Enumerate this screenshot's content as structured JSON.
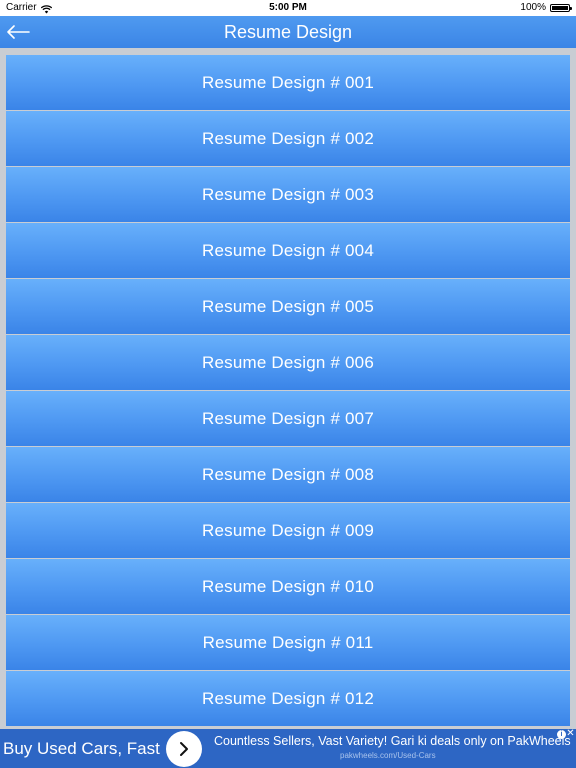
{
  "status_bar": {
    "carrier": "Carrier",
    "time": "5:00 PM",
    "battery": "100%"
  },
  "nav": {
    "title": "Resume Design",
    "back_icon": "back-arrow-icon"
  },
  "list": {
    "items": [
      "Resume Design # 001",
      "Resume Design # 002",
      "Resume Design # 003",
      "Resume Design # 004",
      "Resume Design # 005",
      "Resume Design # 006",
      "Resume Design # 007",
      "Resume Design # 008",
      "Resume Design # 009",
      "Resume Design # 010",
      "Resume Design # 011",
      "Resume Design # 012"
    ]
  },
  "ad": {
    "headline": "Buy Used Cars, Fast",
    "description": "Countless Sellers, Vast Variety! Gari ki deals only on PakWheels",
    "url": "pakwheels.com/Used-Cars",
    "info_label": "i",
    "close_label": "✕"
  },
  "colors": {
    "nav_bar": "#4f9af0",
    "list_item_top": "#68b0fb",
    "list_item_bottom": "#3a84e8",
    "ad_background": "#2d66c4"
  }
}
